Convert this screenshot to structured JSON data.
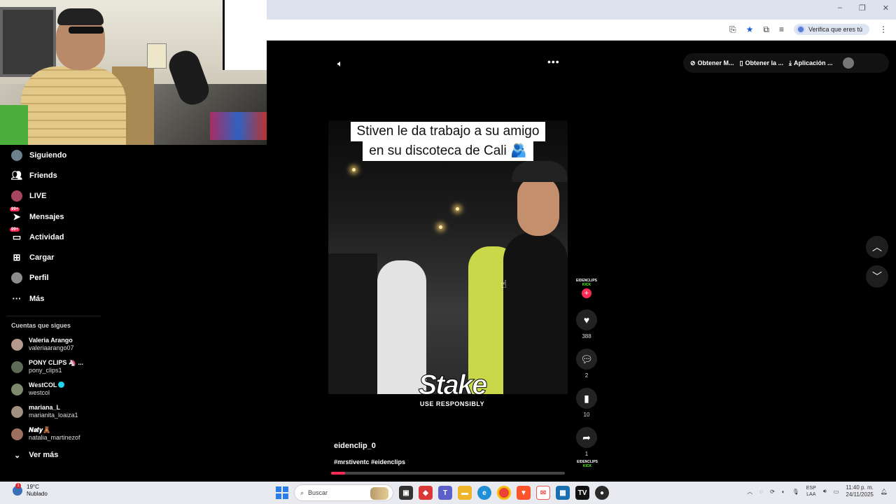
{
  "window": {
    "minimize_icon": "minimize-icon",
    "maximize_icon": "maximize-icon",
    "close_icon": "close-icon"
  },
  "toolbar": {
    "verify_label": "Verifica que eres tú"
  },
  "sidebar": {
    "items": [
      {
        "label": "Siguiendo",
        "icon": "following-avatar",
        "badge": ""
      },
      {
        "label": "Friends",
        "icon": "friends-icon",
        "badge": ""
      },
      {
        "label": "LIVE",
        "icon": "live-icon",
        "badge": ""
      },
      {
        "label": "Mensajes",
        "icon": "messages-icon",
        "badge": "99+"
      },
      {
        "label": "Actividad",
        "icon": "activity-icon",
        "badge": "99+"
      },
      {
        "label": "Cargar",
        "icon": "upload-icon",
        "badge": ""
      },
      {
        "label": "Perfil",
        "icon": "profile-avatar",
        "badge": ""
      },
      {
        "label": "Más",
        "icon": "more-icon",
        "badge": ""
      }
    ],
    "following_title": "Cuentas que sigues",
    "accounts": [
      {
        "name": "Valeria Arango",
        "handle": "valeriaarango07",
        "verified": false
      },
      {
        "name": "PONY CLIPS 🦄 ...",
        "handle": "pony_clips1",
        "verified": false
      },
      {
        "name": "WestCOL",
        "handle": "westcol",
        "verified": true
      },
      {
        "name": "mariana_L",
        "handle": "marianita_loaiza1",
        "verified": false
      },
      {
        "name": "𝑵𝒂𝒕𝒚🧸",
        "handle": "natalia_martinezof",
        "verified": false
      }
    ],
    "see_more": "Ver más"
  },
  "top_actions": {
    "get_m": "Obtener M...",
    "get_la": "Obtener la ...",
    "app": "Aplicación ..."
  },
  "video": {
    "caption_line1": "Stiven le da trabajo a su amigo",
    "caption_line2": "en su discoteca de Cali 🫂",
    "stake_logo": "Stake",
    "stake_tagline": "USE RESPONSIBLY",
    "author": "eidenclip_0",
    "hashtags": "#mrstiventc #eidenclips",
    "progress": 0.06,
    "creator_logo_top": "EIDENCLIPS",
    "creator_logo_bottom": "KICK"
  },
  "actions": {
    "likes": "388",
    "comments": "2",
    "saves": "10",
    "shares": "1"
  },
  "taskbar": {
    "temperature": "19°C",
    "weather": "Nublado",
    "weather_badge": "1",
    "search_placeholder": "Buscar",
    "lang_top": "ESP",
    "lang_bottom": "LAA",
    "time": "11:40 p. m.",
    "date": "24/11/2025"
  },
  "colors": {
    "accent": "#fe2c55",
    "kick_green": "#53fc18",
    "verified": "#20d5ec"
  }
}
